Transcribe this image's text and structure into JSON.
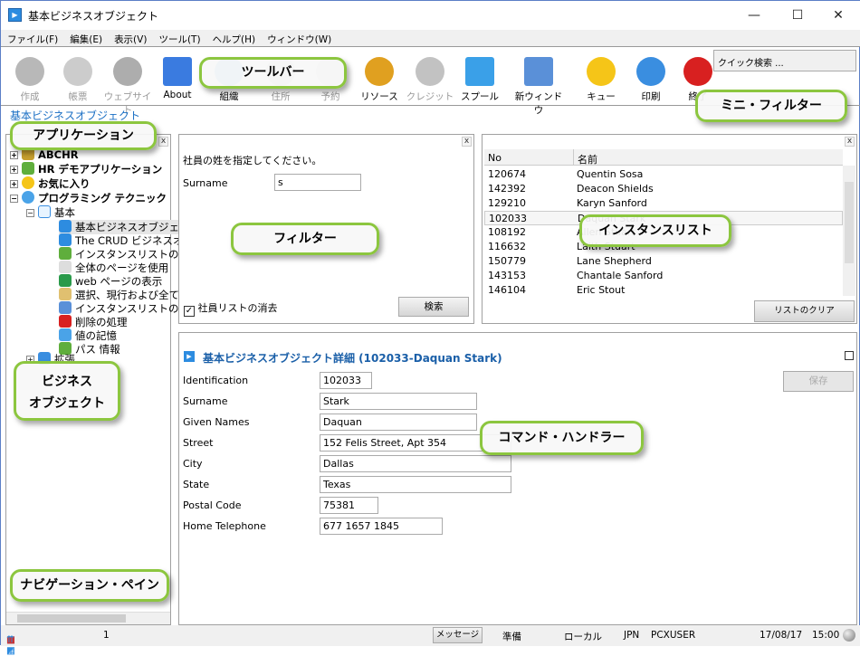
{
  "window": {
    "title": "基本ビジネスオブジェクト",
    "minimize": "—",
    "maximize": "☐",
    "close": "✕"
  },
  "menu": [
    "ファイル(F)",
    "編集(E)",
    "表示(V)",
    "ツール(T)",
    "ヘルプ(H)",
    "ウィンドウ(W)"
  ],
  "toolbar": [
    {
      "label": "作成",
      "icon": "plus-icon",
      "disabled": true
    },
    {
      "label": "帳票",
      "icon": "folder-icon",
      "disabled": true
    },
    {
      "label": "ウェブサイト",
      "icon": "globe-icon",
      "disabled": true
    },
    {
      "label": "About",
      "icon": "about-icon",
      "disabled": false
    },
    {
      "label": "組織",
      "icon": "gear-icon",
      "disabled": false
    },
    {
      "label": "住所",
      "icon": "envelope-icon",
      "disabled": true
    },
    {
      "label": "予約",
      "icon": "clock-icon",
      "disabled": true
    },
    {
      "label": "リソース",
      "icon": "user-icon",
      "disabled": false
    },
    {
      "label": "クレジット",
      "icon": "database-icon",
      "disabled": true
    },
    {
      "label": "スプール",
      "icon": "document-icon",
      "disabled": false
    },
    {
      "label": "新ウィンドウ",
      "icon": "link-window-icon",
      "disabled": false
    },
    {
      "label": "キュー",
      "icon": "warning-icon",
      "disabled": false
    },
    {
      "label": "印刷",
      "icon": "printer-icon",
      "disabled": false
    },
    {
      "label": "終了",
      "icon": "exit-icon",
      "disabled": false
    }
  ],
  "quick_search": "クイック検索 ...",
  "breadcrumb": "基本ビジネスオブジェクト",
  "tree": {
    "roots": [
      "ABCHR",
      "HR デモアプリケーション",
      "お気に入り",
      "プログラミング テクニック"
    ],
    "group": "基本",
    "items": [
      "基本ビジネスオブジェクト",
      "The CRUD ビジネスオブジェクト",
      "インスタンスリストの自動埋め込み",
      "全体のページを使用",
      "web ページの表示",
      "選択、現行および全て",
      "インスタンスリストのスナップイン",
      "削除の処理",
      "値の記憶",
      "パス 情報"
    ],
    "extra": "拡張"
  },
  "filter": {
    "prompt": "社員の姓を指定してください。",
    "surname_label": "Surname",
    "surname_value": "s",
    "clear_checkbox": "社員リストの消去",
    "search_button": "検索"
  },
  "list": {
    "columns": [
      "No",
      "名前"
    ],
    "rows": [
      [
        "120674",
        "Quentin Sosa"
      ],
      [
        "142392",
        "Deacon Shields"
      ],
      [
        "129210",
        "Karyn Sanford"
      ],
      [
        "102033",
        "Daquan Stark"
      ],
      [
        "108192",
        "Allen Stuart"
      ],
      [
        "116632",
        "Laith Stuart"
      ],
      [
        "150779",
        "Lane Shepherd"
      ],
      [
        "143153",
        "Chantale Sanford"
      ],
      [
        "146104",
        "Eric Stout"
      ]
    ],
    "selected": 3,
    "clear_button": "リストのクリア"
  },
  "detail": {
    "title": "基本ビジネスオブジェクト詳細 (102033-Daquan Stark)",
    "save_button": "保存",
    "fields": [
      {
        "label": "Identification",
        "value": "102033"
      },
      {
        "label": "Surname",
        "value": "Stark"
      },
      {
        "label": "Given Names",
        "value": "Daquan"
      },
      {
        "label": "Street",
        "value": "152 Felis Street, Apt 354"
      },
      {
        "label": "City",
        "value": "Dallas"
      },
      {
        "label": "State",
        "value": "Texas"
      },
      {
        "label": "Postal Code",
        "value": "75381"
      },
      {
        "label": "Home Telephone",
        "value": "677 1657 1845"
      }
    ]
  },
  "status": {
    "count": "1",
    "message_button": "メッセージ",
    "state": "準備",
    "location": "ローカル",
    "lang": "JPN",
    "user": "PCXUSER",
    "date": "17/08/17",
    "time": "15:00"
  },
  "callouts": {
    "toolbar": "ツールバー",
    "mini_filter": "ミニ・フィルター",
    "application": "アプリケーション",
    "filter": "フィルター",
    "instance_list": "インスタンスリスト",
    "business_object": "ビジネス\nオブジェクト",
    "command_handler": "コマンド・ハンドラー",
    "navigation_pane": "ナビゲーション・ペイン"
  }
}
